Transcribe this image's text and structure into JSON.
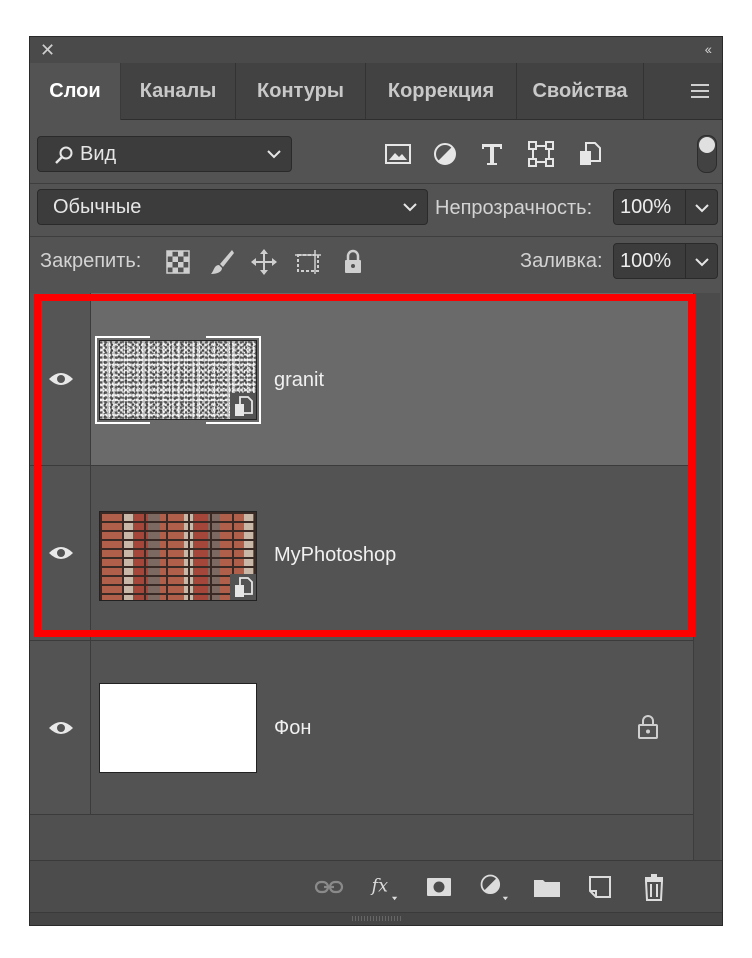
{
  "tabs": [
    "Слои",
    "Каналы",
    "Контуры",
    "Коррекция",
    "Свойства"
  ],
  "filter": {
    "label": "Вид",
    "icons": [
      "image-filter-icon",
      "adjustment-filter-icon",
      "type-filter-icon",
      "shape-filter-icon",
      "smart-object-filter-icon"
    ]
  },
  "blend_mode": "Обычные",
  "opacity": {
    "label": "Непрозрачность:",
    "value": "100%"
  },
  "lock": {
    "label": "Закрепить:"
  },
  "fill": {
    "label": "Заливка:",
    "value": "100%"
  },
  "layers": [
    {
      "name": "granit",
      "thumbnail": "granite-texture",
      "smart_object": true,
      "selected": true,
      "locked": false
    },
    {
      "name": "MyPhotoshop",
      "thumbnail": "brick-wall",
      "smart_object": true,
      "selected": false,
      "locked": false
    },
    {
      "name": "Фон",
      "thumbnail": "white",
      "smart_object": false,
      "selected": false,
      "locked": true
    }
  ],
  "bottom_icons": [
    "link-layers-icon",
    "fx-icon",
    "layer-mask-icon",
    "adjustment-layer-icon",
    "new-group-icon",
    "new-layer-icon",
    "delete-icon"
  ],
  "colors": {
    "panel": "#535353",
    "highlight": "#ff0000",
    "selected_layer": "#6a6a6a"
  }
}
